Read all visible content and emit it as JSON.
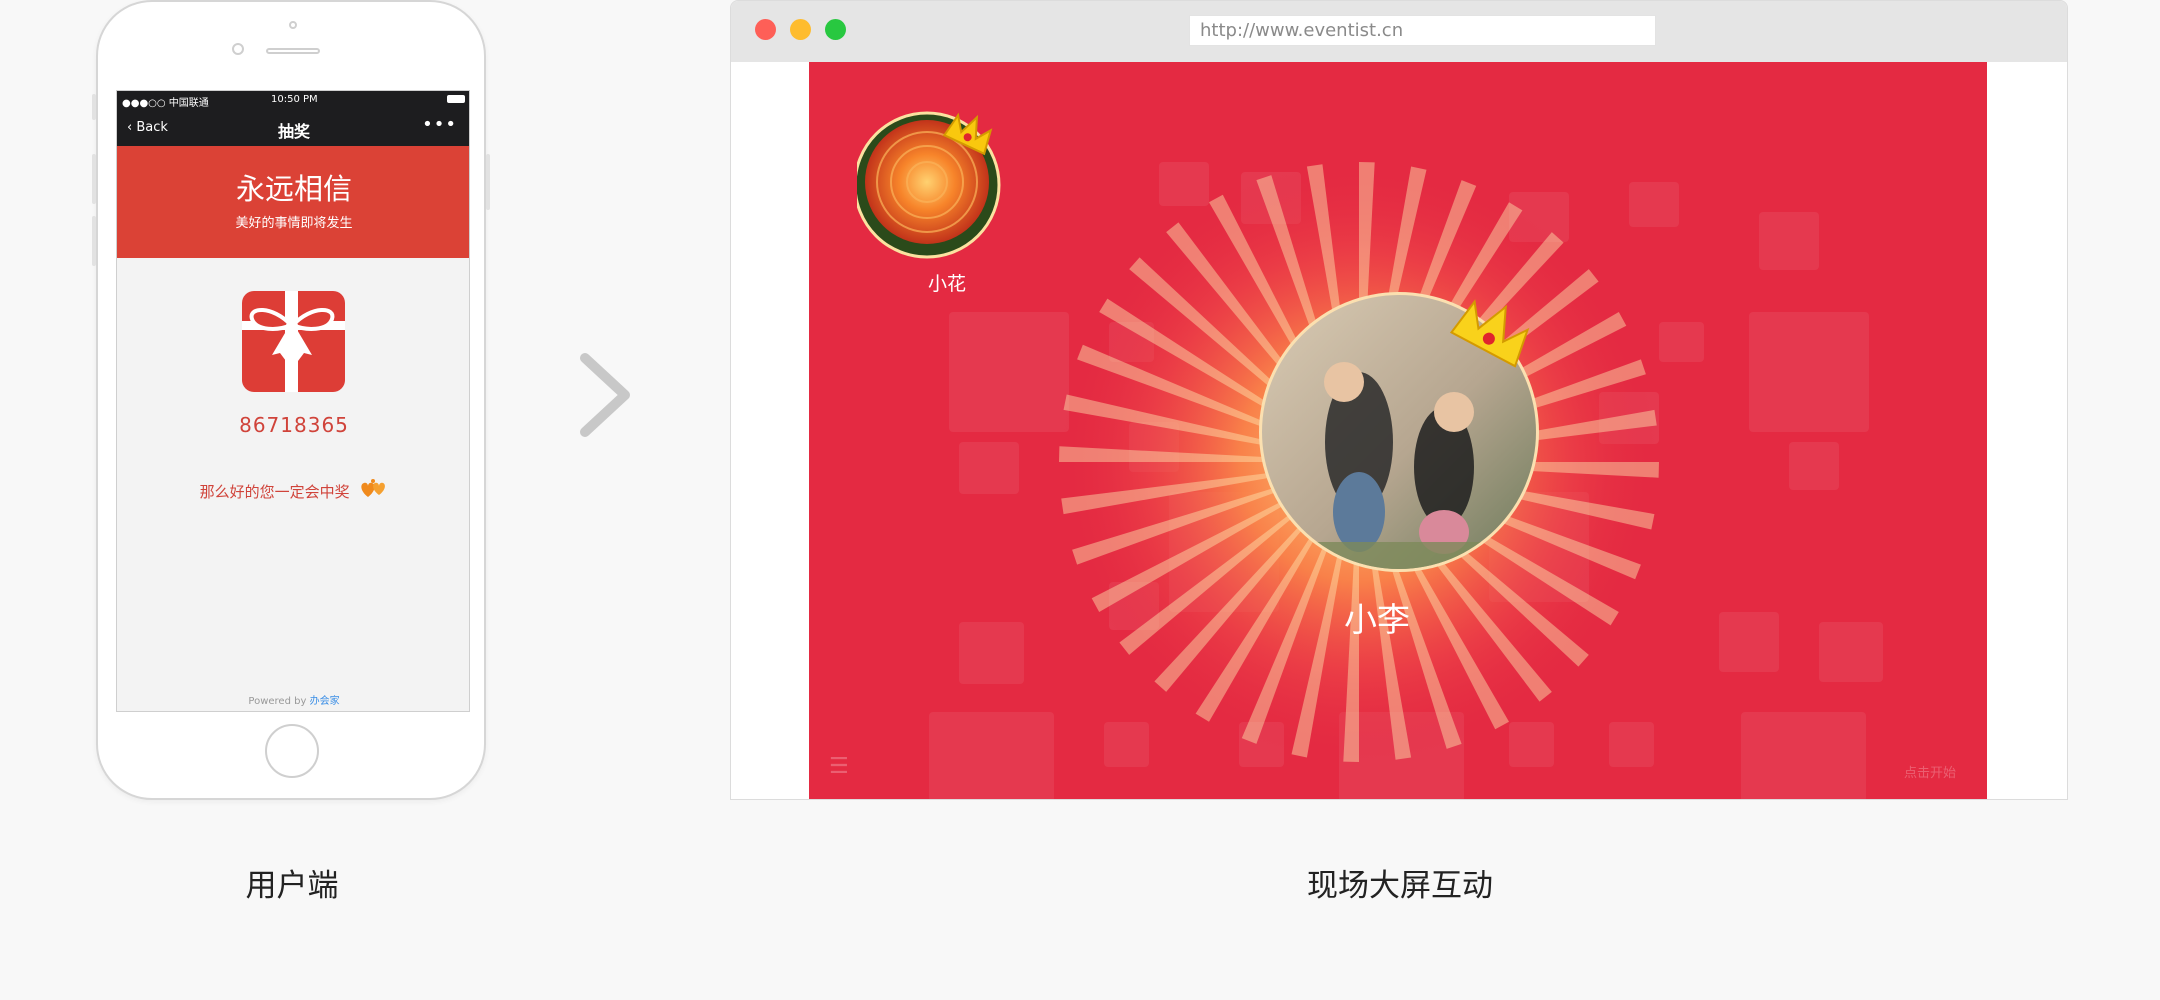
{
  "phone": {
    "statusbar": {
      "carrier": "●●●○○ 中国联通",
      "time": "10:50 PM"
    },
    "nav": {
      "back_label": "Back",
      "title": "抽奖",
      "more_label": "•••"
    },
    "banner": {
      "title": "永远相信",
      "subtitle": "美好的事情即将发生"
    },
    "lottery_code": "86718365",
    "lucky_text": "那么好的您一定会中奖",
    "footer": {
      "powered_prefix": "Powered by",
      "brand": "办会家"
    }
  },
  "browser": {
    "url": "http://www.eventist.cn",
    "winners": {
      "small_name": "小花",
      "big_name": "小李"
    },
    "menu_icon": "☰",
    "start_label": "点击开始"
  },
  "captions": {
    "left": "用户端",
    "right": "现场大屏互动"
  },
  "colors": {
    "page_bg": "#f8f8f8",
    "phone_banner": "#db4236",
    "stage_red": "#e42a42",
    "accent_text": "#d0433a",
    "traffic_red": "#fe5f57",
    "traffic_yellow": "#febc2e",
    "traffic_green": "#28c840"
  },
  "icons": [
    "chevron-left-icon",
    "more-icon",
    "gift-icon",
    "heart-icon",
    "arrow-right-icon",
    "crown-icon",
    "menu-icon"
  ]
}
